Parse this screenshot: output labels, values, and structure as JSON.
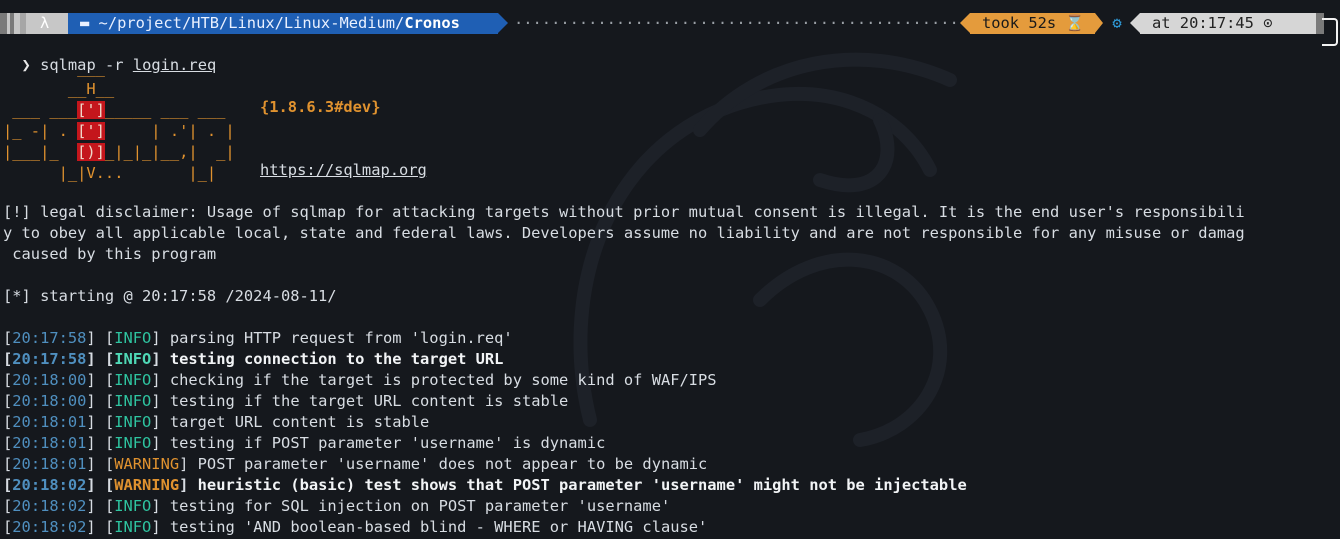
{
  "prompt": {
    "lambda": "λ",
    "folder_icon": "folder-icon",
    "path_prefix": "~/project/HTB/Linux/Linux-Medium/",
    "path_current": "Cronos",
    "took": "took 52s",
    "hourglass_icon": "⌛",
    "gear_icon": "⚙",
    "at_time": "at 20:17:45",
    "clock_icon": "⊙"
  },
  "command": {
    "chevron": "❯",
    "program": "sqlmap",
    "option": "-r",
    "argument": "login.req"
  },
  "banner": {
    "version": "{1.8.6.3#dev}",
    "url": "https://sqlmap.org"
  },
  "disclaimer": [
    "[!] legal disclaimer: Usage of sqlmap for attacking targets without prior mutual consent is illegal. It is the end user's responsibili",
    "y to obey all applicable local, state and federal laws. Developers assume no liability and are not responsible for any misuse or damag",
    " caused by this program"
  ],
  "starting": "[*] starting @ 20:17:58 /2024-08-11/",
  "log": [
    {
      "time": "20:17:58",
      "level": "INFO",
      "msg": "parsing HTTP request from 'login.req'",
      "bold": false
    },
    {
      "time": "20:17:58",
      "level": "INFO",
      "msg": "testing connection to the target URL",
      "bold": true
    },
    {
      "time": "20:18:00",
      "level": "INFO",
      "msg": "checking if the target is protected by some kind of WAF/IPS",
      "bold": false
    },
    {
      "time": "20:18:00",
      "level": "INFO",
      "msg": "testing if the target URL content is stable",
      "bold": false
    },
    {
      "time": "20:18:01",
      "level": "INFO",
      "msg": "target URL content is stable",
      "bold": false
    },
    {
      "time": "20:18:01",
      "level": "INFO",
      "msg": "testing if POST parameter 'username' is dynamic",
      "bold": false
    },
    {
      "time": "20:18:01",
      "level": "WARNING",
      "msg": "POST parameter 'username' does not appear to be dynamic",
      "bold": false
    },
    {
      "time": "20:18:02",
      "level": "WARNING",
      "msg": "heuristic (basic) test shows that POST parameter 'username' might not be injectable",
      "bold": true
    },
    {
      "time": "20:18:02",
      "level": "INFO",
      "msg": "testing for SQL injection on POST parameter 'username'",
      "bold": false
    },
    {
      "time": "20:18:02",
      "level": "INFO",
      "msg": "testing 'AND boolean-based blind - WHERE or HAVING clause'",
      "bold": false
    }
  ],
  "colors": {
    "background": "#15181d",
    "path_segment": "#1f5fb4",
    "took_segment": "#e49b3c",
    "info": "#2ec4a0",
    "warning": "#e0922f",
    "timestamp": "#4f8fbf"
  }
}
